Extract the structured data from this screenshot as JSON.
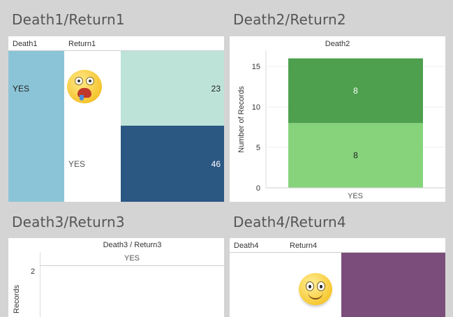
{
  "dashboard": {
    "titles": [
      "Death1/Return1",
      "Death2/Return2",
      "Death3/Return3",
      "Death4/Return4"
    ]
  },
  "panel1": {
    "col1_header": "Death1",
    "col2_header": "Return1",
    "row_label": "YES",
    "sub_label": "YES",
    "values": [
      "23",
      "46"
    ],
    "colors": {
      "rowband": "#8cc4d7",
      "light": "#bde3d9",
      "dark": "#2b5783"
    }
  },
  "panel2": {
    "chart_data": {
      "type": "bar",
      "title": "Death2",
      "ylabel": "Number of Records",
      "categories": [
        "YES"
      ],
      "series": [
        {
          "values": [
            8
          ],
          "color": "#86d37c"
        },
        {
          "values": [
            8
          ],
          "color": "#4ea04e"
        }
      ],
      "yticks": [
        "0",
        "5",
        "10",
        "15"
      ],
      "ylim": [
        0,
        17
      ],
      "data_labels": [
        "8",
        "8"
      ],
      "stacked": true
    }
  },
  "panel3": {
    "title": "Death3 / Return3",
    "category": "YES",
    "ytick": "2",
    "ylabel": "Records"
  },
  "panel4": {
    "col1_header": "Death4",
    "col2_header": "Return4",
    "colors": {
      "block": "#7b4d7a"
    }
  }
}
